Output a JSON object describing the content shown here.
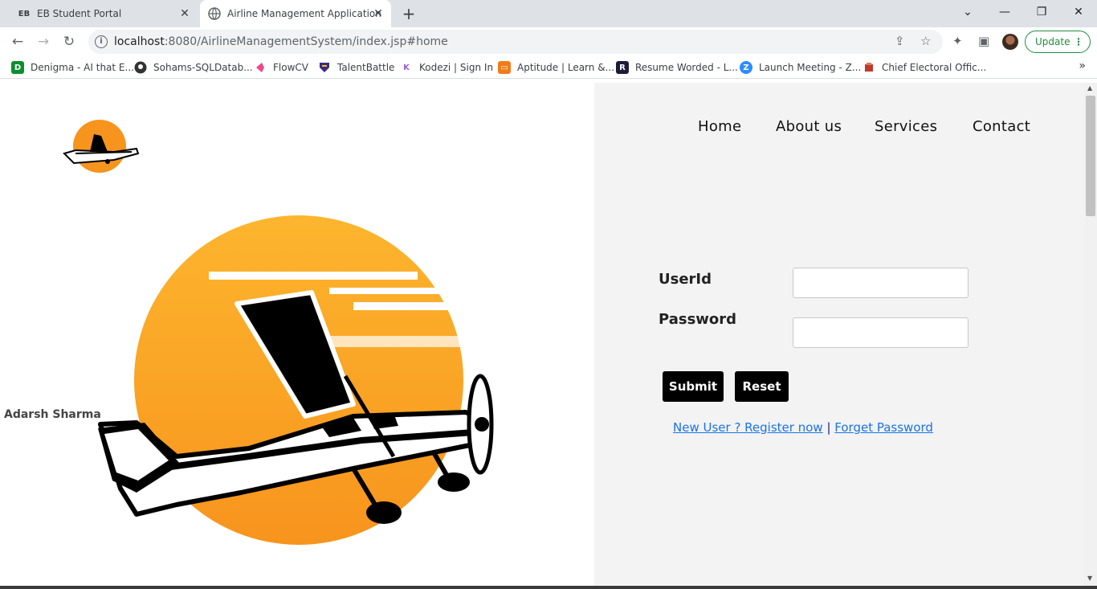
{
  "browser": {
    "tabs": [
      {
        "title": "EB Student Portal",
        "favicon": "EB"
      },
      {
        "title": "Airline Management Application"
      }
    ],
    "url_host": "localhost",
    "url_rest": ":8080/AirlineManagementSystem/index.jsp#home",
    "update_label": "Update",
    "bookmarks": [
      {
        "label": "Denigma - AI that E...",
        "icon_text": "D",
        "color": "#0b8f2e"
      },
      {
        "label": "Sohams-SQLDatab...",
        "icon_text": "",
        "color": "#444444"
      },
      {
        "label": "FlowCV",
        "icon_text": "",
        "color": "#e84a8a"
      },
      {
        "label": "TalentBattle",
        "icon_text": "",
        "color": "#3b2a8a"
      },
      {
        "label": "Kodezi | Sign In",
        "icon_text": "K",
        "color": "#ffffff"
      },
      {
        "label": "Aptitude | Learn &...",
        "icon_text": "",
        "color": "#f07d1a"
      },
      {
        "label": "Resume Worded - L...",
        "icon_text": "R",
        "color": "#1c1c3a"
      },
      {
        "label": "Launch Meeting - Z...",
        "icon_text": "Z",
        "color": "#2d8cff"
      },
      {
        "label": "Chief Electoral Offic...",
        "icon_text": "",
        "color": "#c0392b"
      }
    ]
  },
  "nav": {
    "home": "Home",
    "about": "About us",
    "services": "Services",
    "contact": "Contact"
  },
  "author": "Adarsh Sharma",
  "form": {
    "userid_label": "UserId",
    "password_label": "Password",
    "userid_value": "",
    "password_value": "",
    "submit": "Submit",
    "reset": "Reset",
    "register_link": "New User ? Register now",
    "separator": "|",
    "forget_link": "Forget Password"
  },
  "colors": {
    "accent_orange": "#f7941d",
    "panel_bg": "#f3f3f3",
    "link": "#1a73e8",
    "update_green": "#1e8e3e"
  }
}
